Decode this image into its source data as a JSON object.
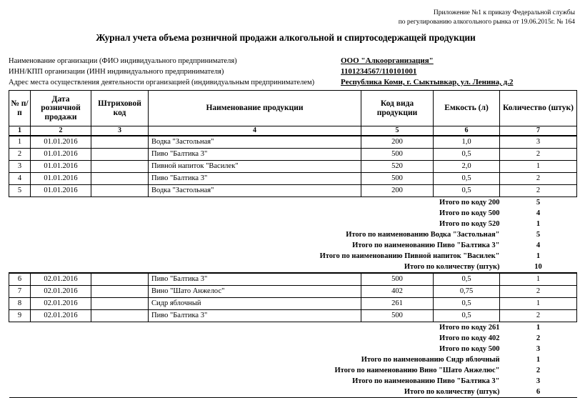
{
  "appendix": {
    "line1": "Приложение №1 к приказу Федеральной службы",
    "line2": "по регулированию алкогольного рынка от 19.06.2015г. № 164"
  },
  "title": "Журнал учета объема розничной продажи алкогольной и спиртосодержащей продукции",
  "organization": {
    "rows": [
      {
        "label": "Наименование организации (ФИО индивидуального предпринимателя)",
        "value": "ООО \"Алкоорганизация\""
      },
      {
        "label": "ИНН/КПП организации (ИНН индивидуального предпринимателя)",
        "value": "1101234567/110101001"
      },
      {
        "label": "Адрес места осуществления деятельности организацией (индивидуальным предпринимателем)",
        "value": "Республика Коми, г. Сыктывкар, ул. Ленина, д.2"
      }
    ]
  },
  "table": {
    "headers": [
      "№ п/п",
      "Дата розничной продажи",
      "Штриховой код",
      "Наименование продукции",
      "Код вида продукции",
      "Емкость (л)",
      "Количество (штук)"
    ],
    "column_numbers": [
      "1",
      "2",
      "3",
      "4",
      "5",
      "6",
      "7"
    ],
    "blocks": [
      {
        "rows": [
          {
            "num": "1",
            "date": "01.01.2016",
            "barcode": "",
            "name": "Водка \"Застольная\"",
            "code": "200",
            "volume": "1,0",
            "qty": "3"
          },
          {
            "num": "2",
            "date": "01.01.2016",
            "barcode": "",
            "name": "Пиво \"Балтика 3\"",
            "code": "500",
            "volume": "0,5",
            "qty": "2"
          },
          {
            "num": "3",
            "date": "01.01.2016",
            "barcode": "",
            "name": "Пивной напиток \"Василек\"",
            "code": "520",
            "volume": "2,0",
            "qty": "1"
          },
          {
            "num": "4",
            "date": "01.01.2016",
            "barcode": "",
            "name": "Пиво \"Балтика 3\"",
            "code": "500",
            "volume": "0,5",
            "qty": "2"
          },
          {
            "num": "5",
            "date": "01.01.2016",
            "barcode": "",
            "name": "Водка \"Застольная\"",
            "code": "200",
            "volume": "0,5",
            "qty": "2"
          }
        ],
        "subtotals": [
          {
            "label": "Итого по коду 200",
            "value": "5"
          },
          {
            "label": "Итого по коду 500",
            "value": "4"
          },
          {
            "label": "Итого по коду 520",
            "value": "1"
          },
          {
            "label": "Итого по наименованию Водка \"Застольная\"",
            "value": "5"
          },
          {
            "label": "Итого по наименованию Пиво \"Балтика 3\"",
            "value": "4"
          },
          {
            "label": "Итого по наименованию Пивной напиток \"Василек\"",
            "value": "1"
          },
          {
            "label": "Итого по количеству (штук)",
            "value": "10"
          }
        ]
      },
      {
        "rows": [
          {
            "num": "6",
            "date": "02.01.2016",
            "barcode": "",
            "name": "Пиво \"Балтика 3\"",
            "code": "500",
            "volume": "0,5",
            "qty": "1"
          },
          {
            "num": "7",
            "date": "02.01.2016",
            "barcode": "",
            "name": "Вино \"Шато Анжелос\"",
            "code": "402",
            "volume": "0,75",
            "qty": "2"
          },
          {
            "num": "8",
            "date": "02.01.2016",
            "barcode": "",
            "name": "Сидр яблочный",
            "code": "261",
            "volume": "0,5",
            "qty": "1"
          },
          {
            "num": "9",
            "date": "02.01.2016",
            "barcode": "",
            "name": "Пиво \"Балтика 3\"",
            "code": "500",
            "volume": "0,5",
            "qty": "2"
          }
        ],
        "subtotals": [
          {
            "label": "Итого по коду 261",
            "value": "1"
          },
          {
            "label": "Итого по коду 402",
            "value": "2"
          },
          {
            "label": "Итого по коду 500",
            "value": "3"
          },
          {
            "label": "Итого по наименованию Сидр яблочный",
            "value": "1"
          },
          {
            "label": "Итого по наименованию Вино \"Шато Анжелюс\"",
            "value": "2"
          },
          {
            "label": "Итого по наименованию Пиво \"Балтика 3\"",
            "value": "3"
          },
          {
            "label": "Итого по количеству (штук)",
            "value": "6"
          }
        ]
      }
    ]
  }
}
